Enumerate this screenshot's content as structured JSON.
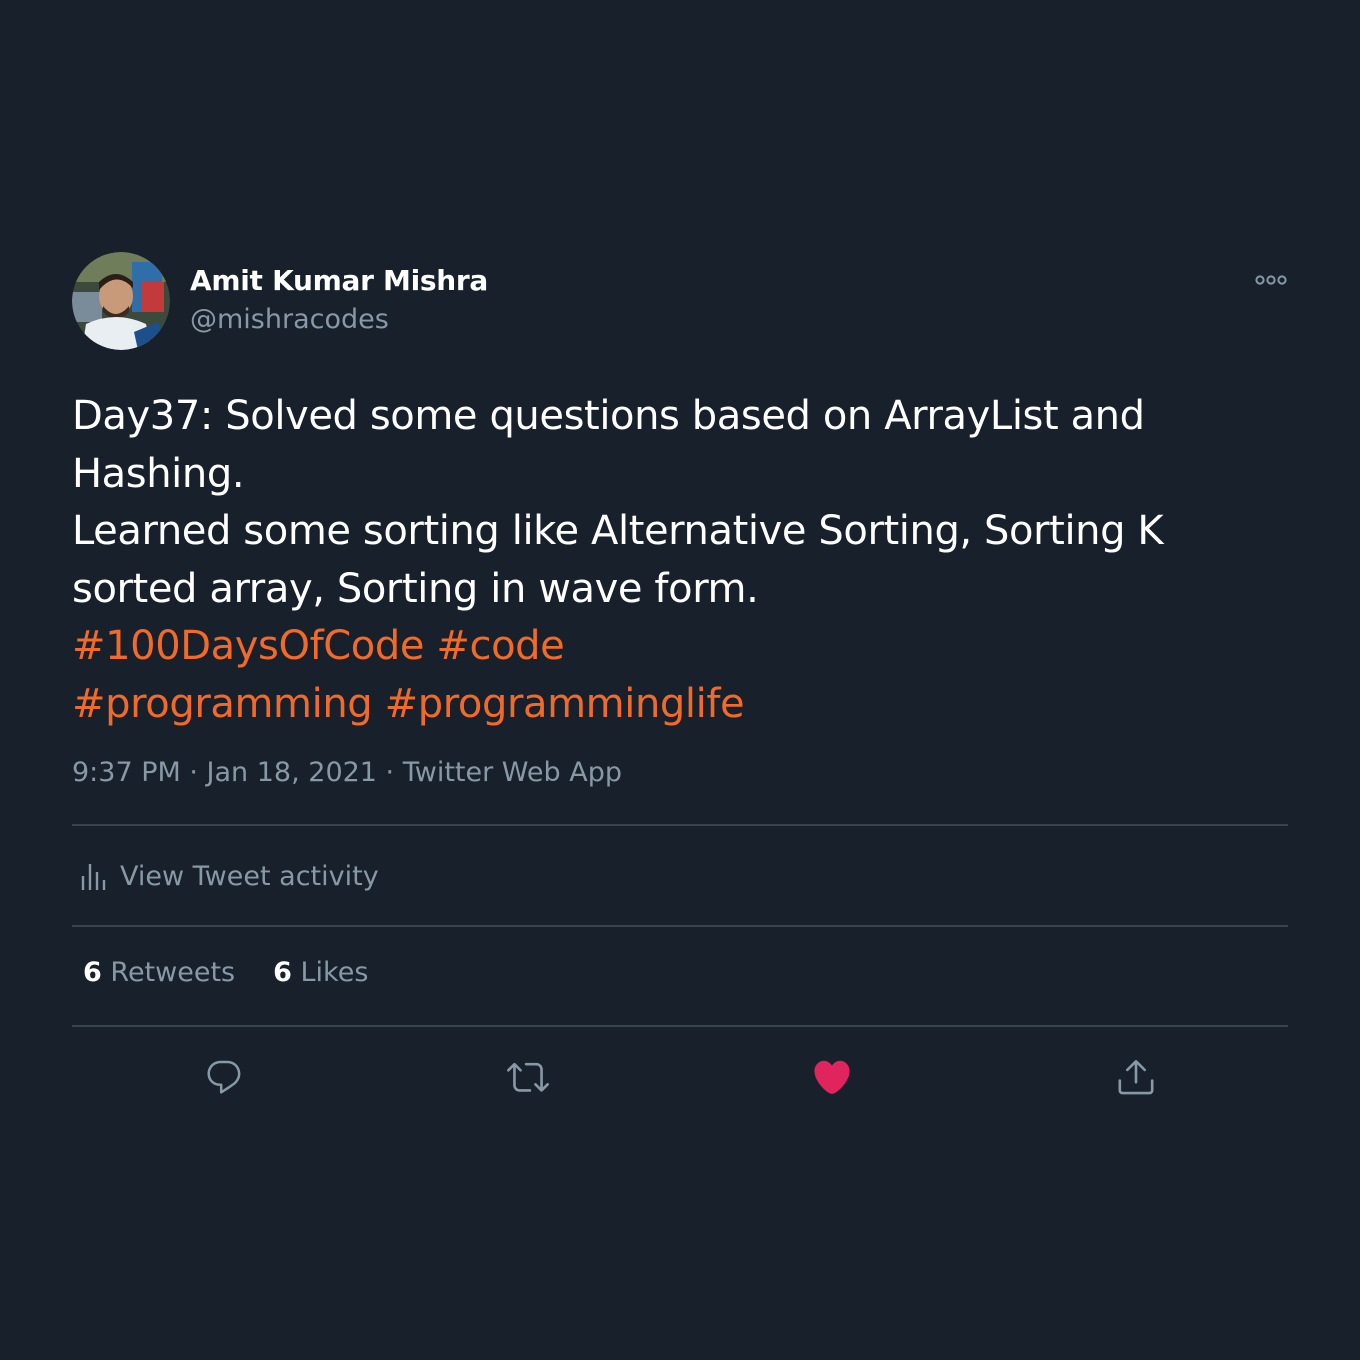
{
  "author": {
    "name": "Amit Kumar Mishra",
    "handle": "@mishracodes"
  },
  "tweet": {
    "lines": [
      "Day37: Solved some questions based on ArrayList and",
      "Hashing.",
      "Learned some sorting like Alternative Sorting, Sorting K",
      "sorted array, Sorting in wave form."
    ],
    "hashtags": [
      "#100DaysOfCode",
      "#code",
      "#programming",
      "#programminglife"
    ],
    "meta": "9:37 PM · Jan 18, 2021 · Twitter Web App"
  },
  "activity": {
    "label": "View Tweet activity",
    "icon": "analytics-icon"
  },
  "stats": {
    "retweets_count": "6",
    "retweets_label": "Retweets",
    "likes_count": "6",
    "likes_label": "Likes"
  },
  "actions": {
    "icons": [
      "reply-icon",
      "retweet-icon",
      "like-icon",
      "share-icon"
    ],
    "liked": true
  },
  "colors": {
    "background": "#17202b",
    "hashtag": "#f26a28",
    "secondary_text": "#8899a6",
    "divider": "#38444d",
    "like": "#e0245e"
  }
}
